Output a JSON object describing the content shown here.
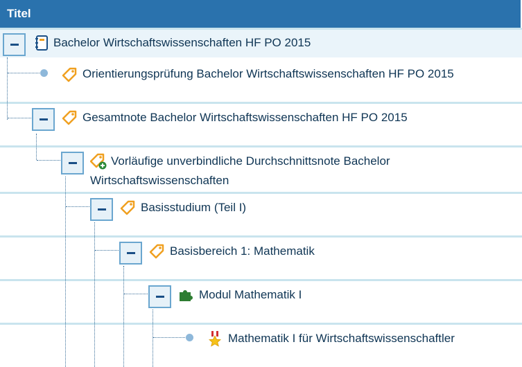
{
  "header": {
    "title": "Titel"
  },
  "rows": [
    {
      "label": "Bachelor Wirtschaftswissenschaften HF PO 2015",
      "icon": "notebook-icon"
    },
    {
      "label": "Orientierungsprüfung Bachelor Wirtschaftswissenschaften HF PO 2015",
      "icon": "tag-icon"
    },
    {
      "label": "Gesamtnote Bachelor Wirtschaftswissenschaften HF PO 2015",
      "icon": "tag-icon"
    },
    {
      "label": "Vorläufige unverbindliche Durchschnittsnote Bachelor Wirtschaftswissenschaften",
      "icon": "tag-add-icon"
    },
    {
      "label": "Basisstudium (Teil I)",
      "icon": "tag-icon"
    },
    {
      "label": "Basisbereich 1: Mathematik",
      "icon": "tag-icon"
    },
    {
      "label": "Modul Mathematik I",
      "icon": "puzzle-icon"
    },
    {
      "label": "Mathematik I für Wirtschaftswissenschaftler",
      "icon": "award-star-icon"
    }
  ]
}
